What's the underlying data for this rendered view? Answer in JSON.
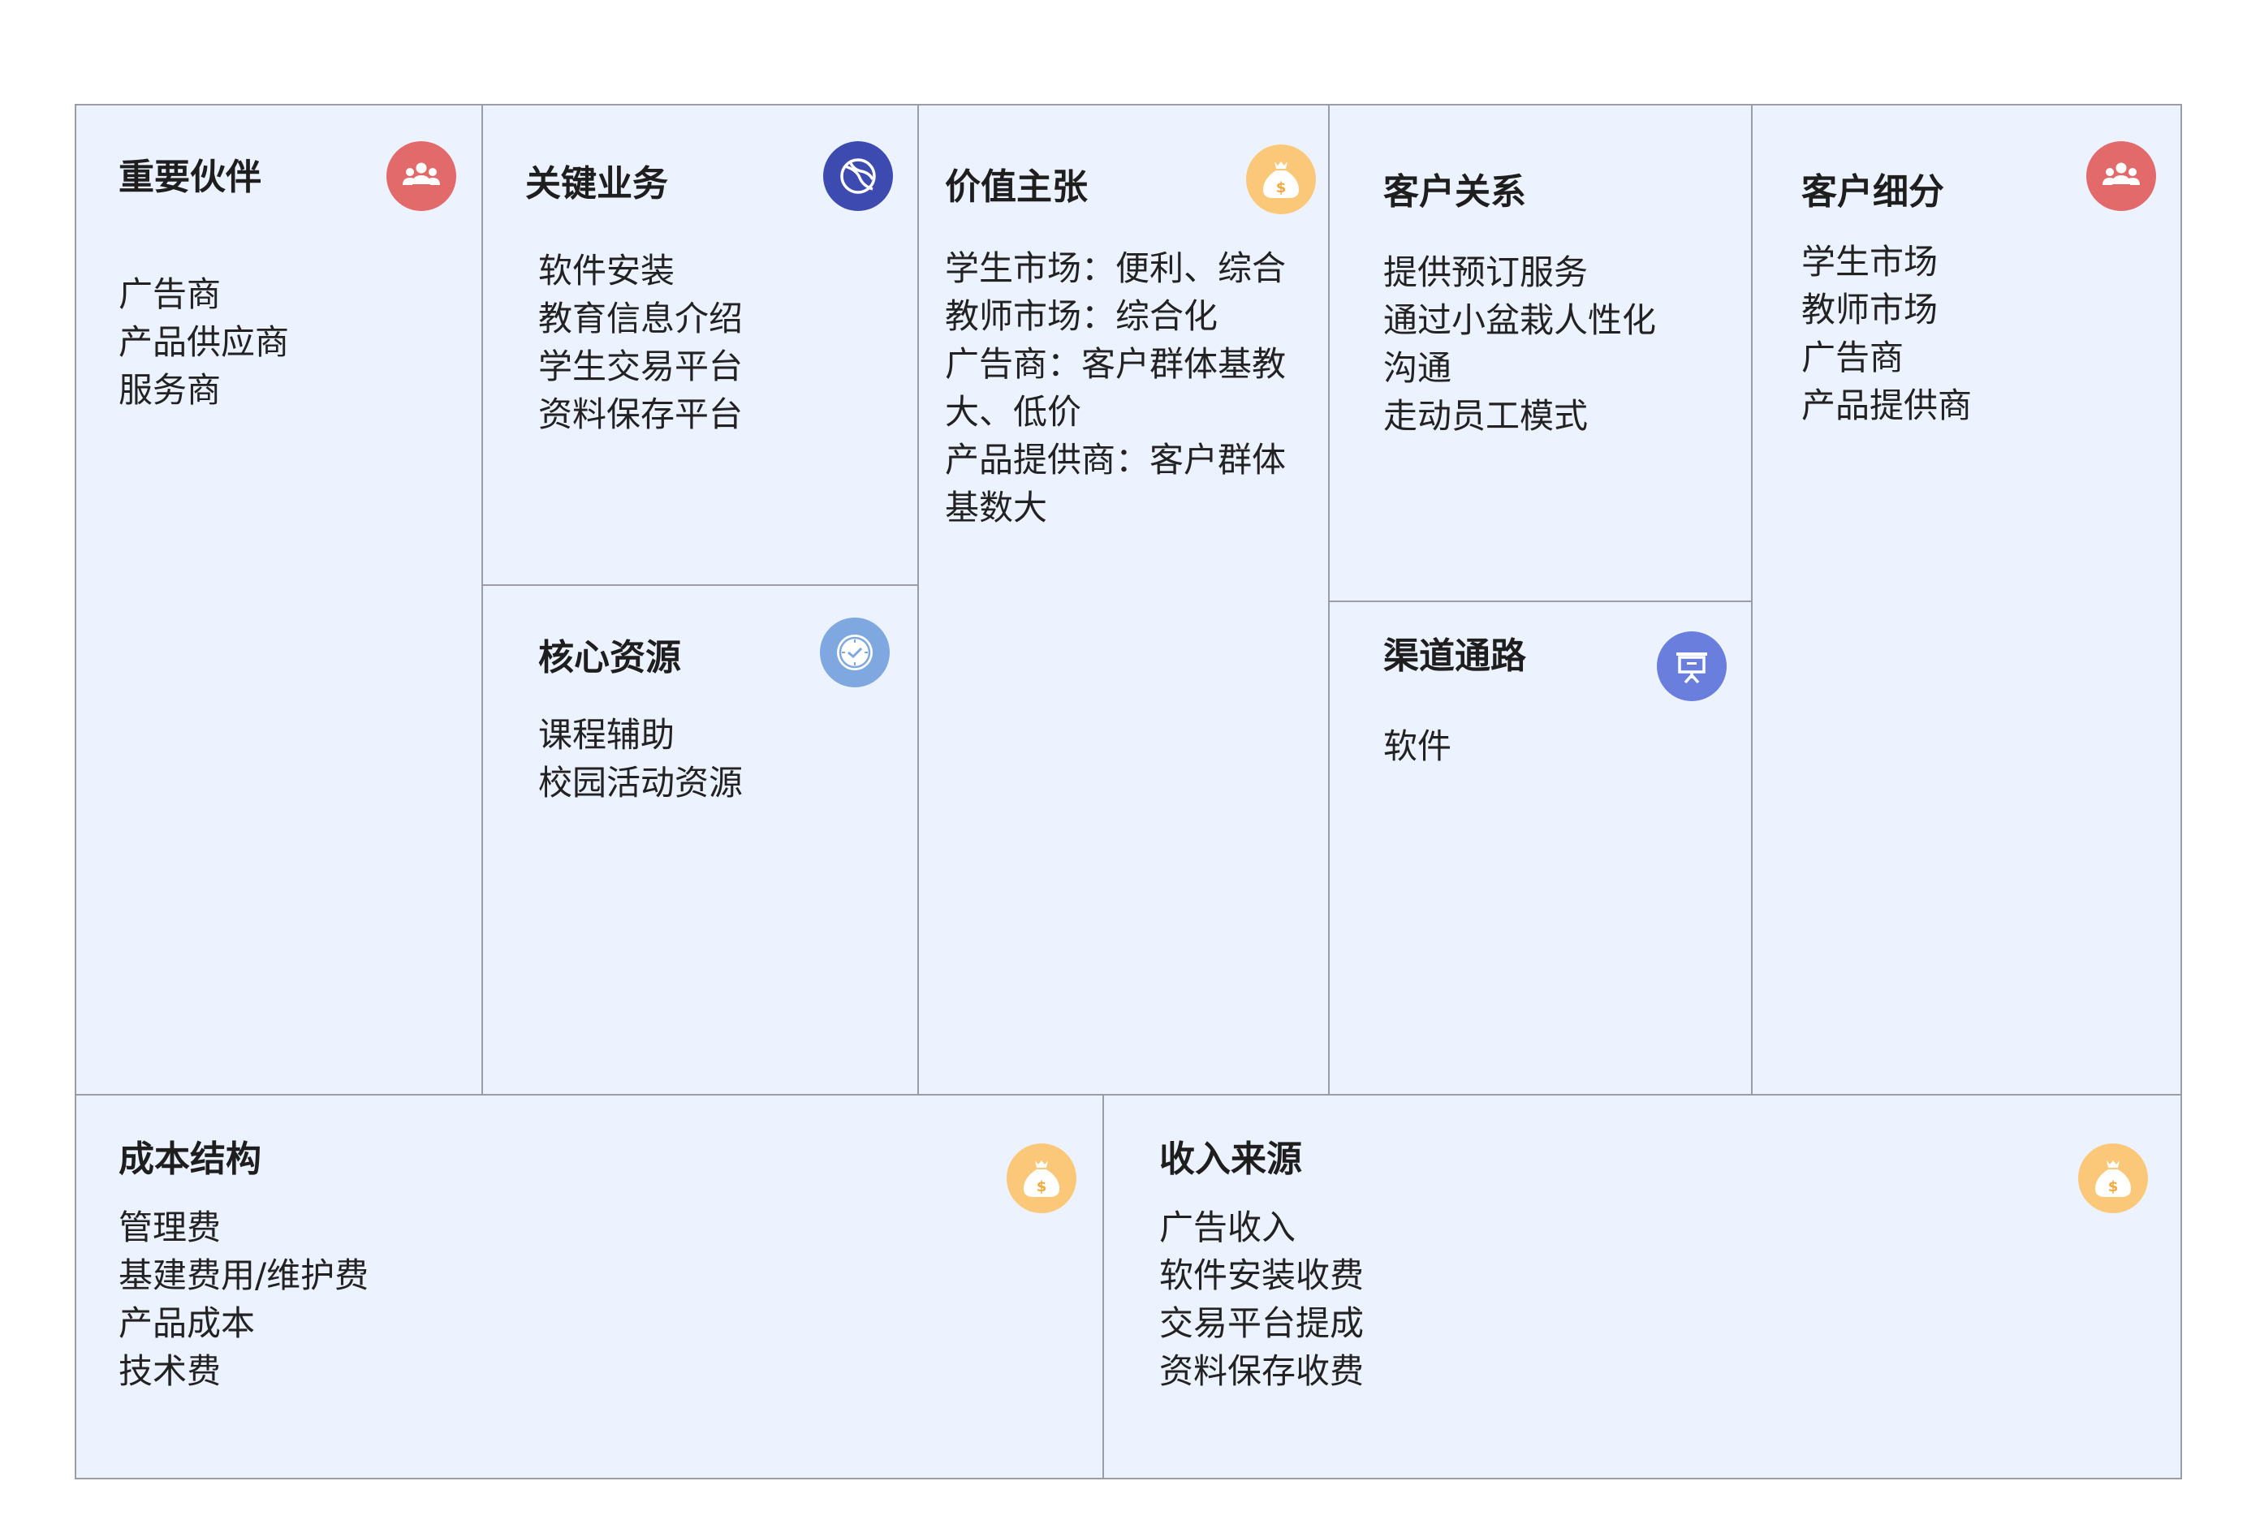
{
  "colors": {
    "cell_bg": "#edf3fe",
    "border": "#9a9da4",
    "people_icon": "#e26a6a",
    "ball_icon": "#3d4bb0",
    "money_icon": "#fbc87a",
    "clock_icon": "#7fa8e0",
    "board_icon": "#6a7fdd"
  },
  "canvas": {
    "key_partners": {
      "title": "重要伙伴",
      "icon": "people-icon",
      "items": [
        "广告商",
        "产品供应商",
        "服务商"
      ]
    },
    "key_activities": {
      "title": "关键业务",
      "icon": "ball-icon",
      "items": [
        "软件安装",
        "教育信息介绍",
        "学生交易平台",
        "资料保存平台"
      ]
    },
    "key_resources": {
      "title": "核心资源",
      "icon": "clock-icon",
      "items": [
        "课程辅助",
        "校园活动资源"
      ]
    },
    "value_propositions": {
      "title": "价值主张",
      "icon": "money-bag-icon",
      "items": [
        "学生市场：便利、综合",
        "教师市场：综合化",
        "广告商：客户群体基教大、低价",
        "产品提供商：客户群体基数大"
      ]
    },
    "customer_relationships": {
      "title": "客户关系",
      "items": [
        "提供预订服务",
        "通过小盆栽人性化沟通",
        "走动员工模式"
      ]
    },
    "channels": {
      "title": "渠道通路",
      "icon": "presentation-board-icon",
      "items": [
        "软件"
      ]
    },
    "customer_segments": {
      "title": "客户细分",
      "icon": "people-icon",
      "items": [
        "学生市场",
        "教师市场",
        "广告商",
        "产品提供商"
      ]
    },
    "cost_structure": {
      "title": "成本结构",
      "icon": "money-bag-icon",
      "items": [
        "管理费",
        "基建费用/维护费",
        "产品成本",
        "技术费"
      ]
    },
    "revenue_streams": {
      "title": "收入来源",
      "icon": "money-bag-icon",
      "items": [
        "广告收入",
        "软件安装收费",
        "交易平台提成",
        "资料保存收费"
      ]
    }
  }
}
